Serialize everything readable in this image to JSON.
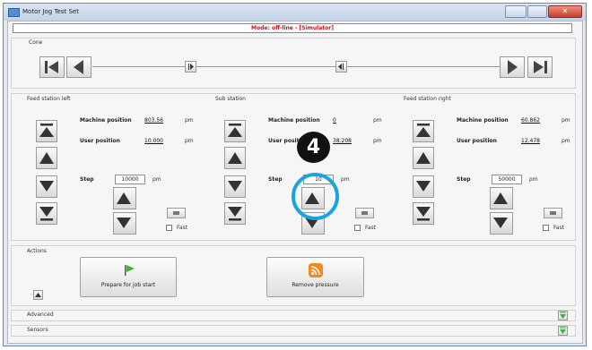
{
  "window": {
    "title": "Motor Jog Test Set"
  },
  "status_text": "Mode: off-line - [Simulator]",
  "cone": {
    "label": "Cone",
    "positions": {
      "thumb1": 0.24,
      "thumb2": 0.61
    }
  },
  "stations": [
    {
      "title": "Feed station left",
      "machine_position_label": "Machine position",
      "machine_position_value": "803.56",
      "user_position_label": "User position",
      "user_position_value": "10.000",
      "unit": "pm",
      "step_label": "Step",
      "step_value": "10000",
      "step_unit": "pm",
      "fast_label": "Fast"
    },
    {
      "title": "Sub station",
      "machine_position_label": "Machine position",
      "machine_position_value": "0",
      "user_position_label": "User position",
      "user_position_value": "38.208",
      "unit": "pm",
      "step_label": "Step",
      "step_value": "10",
      "step_unit": "pm",
      "fast_label": "Fast"
    },
    {
      "title": "Feed station right",
      "machine_position_label": "Machine position",
      "machine_position_value": "60.862",
      "user_position_label": "User position",
      "user_position_value": "12.478",
      "unit": "pm",
      "step_label": "Step",
      "step_value": "50000",
      "step_unit": "pm",
      "fast_label": "Fast"
    }
  ],
  "annotation": {
    "number": "4"
  },
  "actions": {
    "label": "Actions",
    "prepare_label": "Prepare for job start",
    "remove_label": "Remove pressure"
  },
  "advanced": {
    "label": "Advanced"
  },
  "sensors": {
    "label": "Sensors"
  },
  "colors": {
    "status_red": "#cc1111",
    "callout_blue": "#1aa3e0",
    "arrow_green": "#3cb43c",
    "rss_orange": "#f08a1e"
  }
}
